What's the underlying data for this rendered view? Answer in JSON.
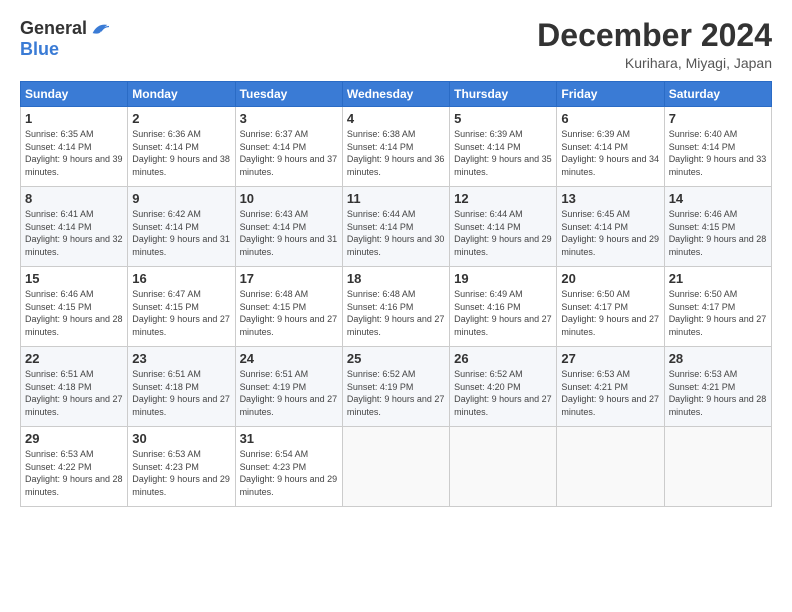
{
  "logo": {
    "general": "General",
    "blue": "Blue"
  },
  "header": {
    "month": "December 2024",
    "location": "Kurihara, Miyagi, Japan"
  },
  "days_of_week": [
    "Sunday",
    "Monday",
    "Tuesday",
    "Wednesday",
    "Thursday",
    "Friday",
    "Saturday"
  ],
  "weeks": [
    [
      {
        "day": "1",
        "sunrise": "6:35 AM",
        "sunset": "4:14 PM",
        "daylight": "9 hours and 39 minutes."
      },
      {
        "day": "2",
        "sunrise": "6:36 AM",
        "sunset": "4:14 PM",
        "daylight": "9 hours and 38 minutes."
      },
      {
        "day": "3",
        "sunrise": "6:37 AM",
        "sunset": "4:14 PM",
        "daylight": "9 hours and 37 minutes."
      },
      {
        "day": "4",
        "sunrise": "6:38 AM",
        "sunset": "4:14 PM",
        "daylight": "9 hours and 36 minutes."
      },
      {
        "day": "5",
        "sunrise": "6:39 AM",
        "sunset": "4:14 PM",
        "daylight": "9 hours and 35 minutes."
      },
      {
        "day": "6",
        "sunrise": "6:39 AM",
        "sunset": "4:14 PM",
        "daylight": "9 hours and 34 minutes."
      },
      {
        "day": "7",
        "sunrise": "6:40 AM",
        "sunset": "4:14 PM",
        "daylight": "9 hours and 33 minutes."
      }
    ],
    [
      {
        "day": "8",
        "sunrise": "6:41 AM",
        "sunset": "4:14 PM",
        "daylight": "9 hours and 32 minutes."
      },
      {
        "day": "9",
        "sunrise": "6:42 AM",
        "sunset": "4:14 PM",
        "daylight": "9 hours and 31 minutes."
      },
      {
        "day": "10",
        "sunrise": "6:43 AM",
        "sunset": "4:14 PM",
        "daylight": "9 hours and 31 minutes."
      },
      {
        "day": "11",
        "sunrise": "6:44 AM",
        "sunset": "4:14 PM",
        "daylight": "9 hours and 30 minutes."
      },
      {
        "day": "12",
        "sunrise": "6:44 AM",
        "sunset": "4:14 PM",
        "daylight": "9 hours and 29 minutes."
      },
      {
        "day": "13",
        "sunrise": "6:45 AM",
        "sunset": "4:14 PM",
        "daylight": "9 hours and 29 minutes."
      },
      {
        "day": "14",
        "sunrise": "6:46 AM",
        "sunset": "4:15 PM",
        "daylight": "9 hours and 28 minutes."
      }
    ],
    [
      {
        "day": "15",
        "sunrise": "6:46 AM",
        "sunset": "4:15 PM",
        "daylight": "9 hours and 28 minutes."
      },
      {
        "day": "16",
        "sunrise": "6:47 AM",
        "sunset": "4:15 PM",
        "daylight": "9 hours and 27 minutes."
      },
      {
        "day": "17",
        "sunrise": "6:48 AM",
        "sunset": "4:15 PM",
        "daylight": "9 hours and 27 minutes."
      },
      {
        "day": "18",
        "sunrise": "6:48 AM",
        "sunset": "4:16 PM",
        "daylight": "9 hours and 27 minutes."
      },
      {
        "day": "19",
        "sunrise": "6:49 AM",
        "sunset": "4:16 PM",
        "daylight": "9 hours and 27 minutes."
      },
      {
        "day": "20",
        "sunrise": "6:50 AM",
        "sunset": "4:17 PM",
        "daylight": "9 hours and 27 minutes."
      },
      {
        "day": "21",
        "sunrise": "6:50 AM",
        "sunset": "4:17 PM",
        "daylight": "9 hours and 27 minutes."
      }
    ],
    [
      {
        "day": "22",
        "sunrise": "6:51 AM",
        "sunset": "4:18 PM",
        "daylight": "9 hours and 27 minutes."
      },
      {
        "day": "23",
        "sunrise": "6:51 AM",
        "sunset": "4:18 PM",
        "daylight": "9 hours and 27 minutes."
      },
      {
        "day": "24",
        "sunrise": "6:51 AM",
        "sunset": "4:19 PM",
        "daylight": "9 hours and 27 minutes."
      },
      {
        "day": "25",
        "sunrise": "6:52 AM",
        "sunset": "4:19 PM",
        "daylight": "9 hours and 27 minutes."
      },
      {
        "day": "26",
        "sunrise": "6:52 AM",
        "sunset": "4:20 PM",
        "daylight": "9 hours and 27 minutes."
      },
      {
        "day": "27",
        "sunrise": "6:53 AM",
        "sunset": "4:21 PM",
        "daylight": "9 hours and 27 minutes."
      },
      {
        "day": "28",
        "sunrise": "6:53 AM",
        "sunset": "4:21 PM",
        "daylight": "9 hours and 28 minutes."
      }
    ],
    [
      {
        "day": "29",
        "sunrise": "6:53 AM",
        "sunset": "4:22 PM",
        "daylight": "9 hours and 28 minutes."
      },
      {
        "day": "30",
        "sunrise": "6:53 AM",
        "sunset": "4:23 PM",
        "daylight": "9 hours and 29 minutes."
      },
      {
        "day": "31",
        "sunrise": "6:54 AM",
        "sunset": "4:23 PM",
        "daylight": "9 hours and 29 minutes."
      },
      null,
      null,
      null,
      null
    ]
  ]
}
